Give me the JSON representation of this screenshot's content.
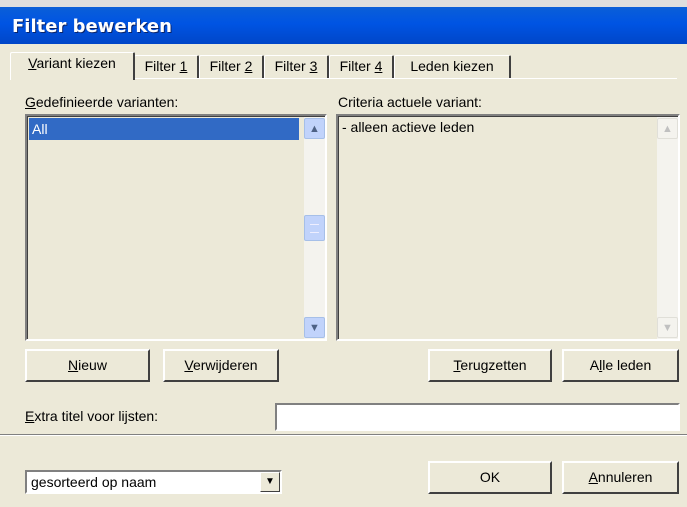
{
  "window": {
    "title": "Filter bewerken"
  },
  "tabs": [
    {
      "label": "Variant kiezen",
      "mnemonic": "V",
      "rest": "ariant kiezen",
      "active": true
    },
    {
      "label": "Filter 1",
      "pre": "Filter ",
      "mnemonic": "1"
    },
    {
      "label": "Filter 2",
      "pre": "Filter ",
      "mnemonic": "2"
    },
    {
      "label": "Filter 3",
      "pre": "Filter ",
      "mnemonic": "3"
    },
    {
      "label": "Filter 4",
      "pre": "Filter ",
      "mnemonic": "4"
    },
    {
      "label": "Leden kiezen"
    }
  ],
  "variants": {
    "label_mnemonic": "G",
    "label_rest": "edefinieerde varianten:",
    "items": [
      "All"
    ],
    "selected": "All"
  },
  "criteria": {
    "label": "Criteria actuele variant:",
    "lines": [
      "- alleen actieve leden"
    ]
  },
  "buttons": {
    "new": {
      "mnemonic": "N",
      "rest": "ieuw"
    },
    "delete": {
      "mnemonic": "V",
      "rest": "erwijderen"
    },
    "reset": {
      "mnemonic": "T",
      "rest": "erugzetten"
    },
    "all_members": {
      "pre": "A",
      "mnemonic": "l",
      "rest": "le leden"
    },
    "ok": {
      "label": "OK"
    },
    "cancel": {
      "mnemonic": "A",
      "rest": "nnuleren"
    }
  },
  "extra_title": {
    "label_mnemonic": "E",
    "label_rest": "xtra titel voor lijsten:",
    "value": ""
  },
  "sort": {
    "selected": "gesorteerd op naam"
  },
  "colors": {
    "titlebar": "#0054e3",
    "selection": "#316ac5",
    "face": "#ece9d8"
  },
  "icons": {
    "scroll_up": "chevron-up-icon",
    "scroll_down": "chevron-down-icon",
    "dropdown": "triangle-down-icon"
  }
}
